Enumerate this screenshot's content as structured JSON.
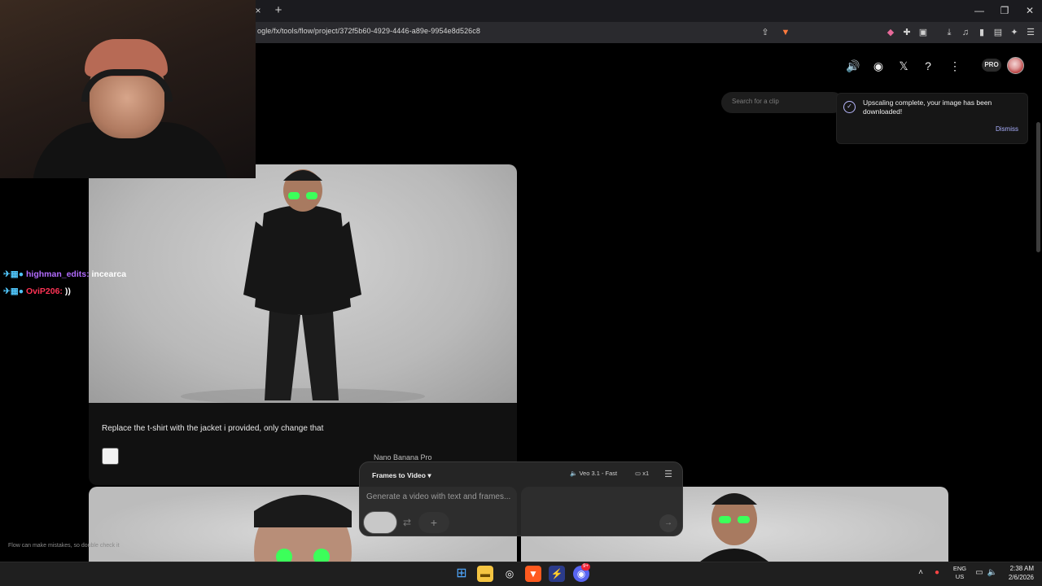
{
  "browser": {
    "tab_close": "×",
    "new_tab": "+",
    "url": "ogle/fx/tools/flow/project/372f5b60-4929-4446-a89e-9954e8d526c8",
    "window_controls": [
      "—",
      "❐",
      "✕"
    ]
  },
  "header": {
    "pro_label": "PRO",
    "icons": [
      "volume-icon",
      "discord-icon",
      "x-icon",
      "help-icon",
      "more-icon"
    ]
  },
  "search": {
    "placeholder": "Search for a clip"
  },
  "toast": {
    "message": "Upscaling complete, your image has been downloaded!",
    "dismiss_label": "Dismiss"
  },
  "chat": [
    {
      "user": "highman_edits:",
      "message": "incearca",
      "color": "#b36cff"
    },
    {
      "user": "OviP206:",
      "message": "))",
      "color": "#ff3355"
    }
  ],
  "card": {
    "prompt": "Replace the t-shirt with the jacket i provided, only change that",
    "model": "Nano Banana Pro"
  },
  "disclaimer": "Flow can make mistakes, so double check it",
  "composer": {
    "mode": "Frames to Video",
    "model": "Veo 3.1 - Fast",
    "count": "x1",
    "placeholder": "Generate a video with text and frames..."
  },
  "taskbar": {
    "lang_line1": "ENG",
    "lang_line2": "US",
    "time": "2:38 AM",
    "date": "2/6/2026",
    "discord_badge": "9+"
  }
}
